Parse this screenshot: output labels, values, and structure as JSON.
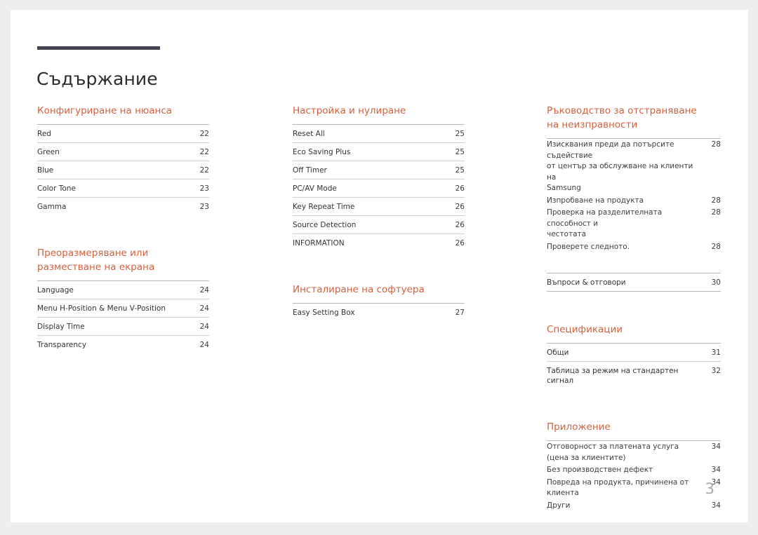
{
  "document": {
    "title": "Съдържание",
    "page_number": "3",
    "accent_color": "#d4603c",
    "title_rule_color": "#474151",
    "page_number_color": "#a8a8ad"
  },
  "columns": [
    {
      "id": "column-1",
      "sections": [
        {
          "heading": "Конфигуриране на нюанса",
          "separators": true,
          "bottom_rule": false,
          "entries": [
            {
              "label": "Red",
              "page": "22"
            },
            {
              "label": "Green",
              "page": "22"
            },
            {
              "label": "Blue",
              "page": "22"
            },
            {
              "label": "Color Tone",
              "page": "23"
            },
            {
              "label": "Gamma",
              "page": "23"
            }
          ]
        },
        {
          "heading": "Преоразмеряване или\nразместване на екрана",
          "separators": true,
          "bottom_rule": false,
          "entries": [
            {
              "label": "Language",
              "page": "24"
            },
            {
              "label": "Menu H-Position & Menu V-Position",
              "page": "24"
            },
            {
              "label": "Display Time",
              "page": "24"
            },
            {
              "label": "Transparency",
              "page": "24"
            }
          ]
        }
      ]
    },
    {
      "id": "column-2",
      "sections": [
        {
          "heading": "Настройка и нулиране",
          "separators": true,
          "bottom_rule": false,
          "entries": [
            {
              "label": "Reset All",
              "page": "25"
            },
            {
              "label": "Eco Saving Plus",
              "page": "25"
            },
            {
              "label": "Off Timer",
              "page": "25"
            },
            {
              "label": "PC/AV Mode",
              "page": "26"
            },
            {
              "label": "Key Repeat Time",
              "page": "26"
            },
            {
              "label": "Source Detection",
              "page": "26"
            },
            {
              "label": "INFORMATION",
              "page": "26"
            }
          ]
        },
        {
          "heading": "Инсталиране на софтуера",
          "separators": true,
          "bottom_rule": false,
          "entries": [
            {
              "label": "Easy Setting Box",
              "page": "27"
            }
          ]
        }
      ]
    },
    {
      "id": "column-3",
      "sections": [
        {
          "heading": "Ръководство за отстраняване\nна неизправности",
          "separators": false,
          "bottom_rule": false,
          "entries": [
            {
              "label": "Изисквания преди да потърсите съдействие\nот център за обслужване на клиенти на\nSamsung",
              "page": "28"
            },
            {
              "label": "Изпробване на продукта",
              "page": "28"
            },
            {
              "label": "Проверка на разделителната способност и\nчестотата",
              "page": "28"
            },
            {
              "label": "Проверете следното.",
              "page": "28"
            }
          ]
        },
        {
          "heading": "",
          "separators": true,
          "bottom_rule": true,
          "entries": [
            {
              "label": "Въпроси & отговори",
              "page": "30"
            }
          ]
        },
        {
          "heading": "Спецификации",
          "separators": true,
          "bottom_rule": false,
          "entries": [
            {
              "label": "Общи",
              "page": "31"
            },
            {
              "label": "Таблица за режим на стандартен сигнал",
              "page": "32"
            }
          ]
        },
        {
          "heading": "Приложение",
          "separators": false,
          "bottom_rule": false,
          "entries": [
            {
              "label": "Отговорност за платената услуга\n(цена за клиентите)",
              "page": "34"
            },
            {
              "label": "Без производствен дефект",
              "page": "34"
            },
            {
              "label": "Повреда на продукта, причинена от клиента",
              "page": "34"
            },
            {
              "label": "Други",
              "page": "34"
            }
          ]
        }
      ]
    }
  ]
}
